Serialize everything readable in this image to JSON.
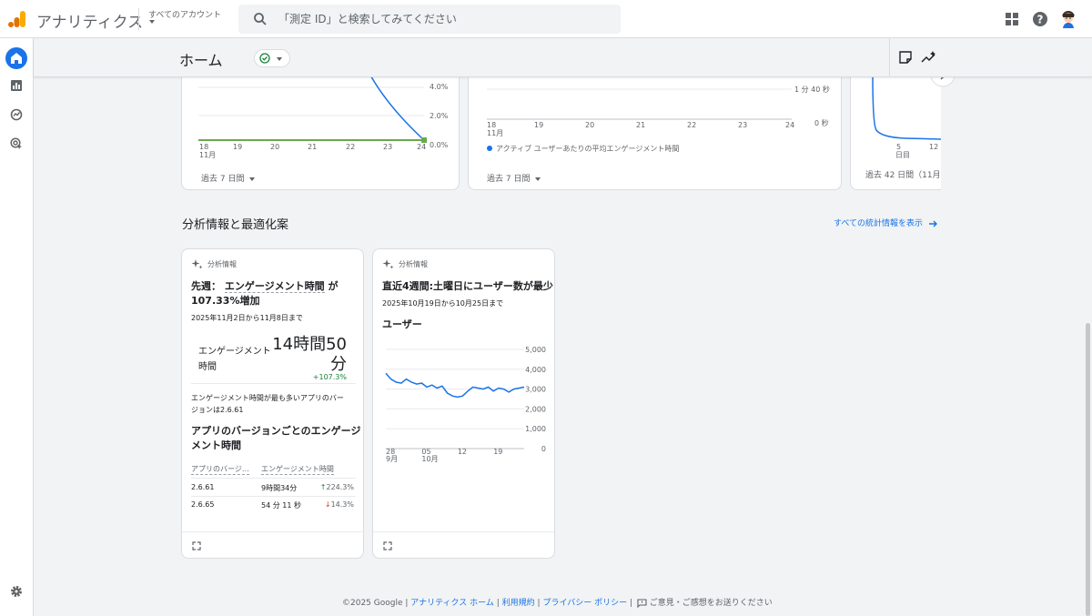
{
  "app": {
    "title": "アナリティクス",
    "account_selector": "すべてのアカウント",
    "search_placeholder": "「測定 ID」と検索してみてください",
    "brand_colors": {
      "accent": "#1a73e8",
      "logo_orange": "#f9ab00",
      "logo_dark_orange": "#e37400"
    }
  },
  "header": {
    "page_title": "ホーム"
  },
  "top_cards": {
    "card1": {
      "y_ticks": [
        "4.0%",
        "2.0%",
        "0.0%"
      ],
      "x_ticks": [
        "18",
        "19",
        "20",
        "21",
        "22",
        "23",
        "24"
      ],
      "x_month": "11月",
      "date_range": "過去 7 日間",
      "line_color": "#1a73e8",
      "baseline_color": "#6aa84f"
    },
    "card2": {
      "y_ticks": [
        "1 分 40 秒",
        "0 秒"
      ],
      "x_ticks": [
        "18",
        "19",
        "20",
        "21",
        "22",
        "23",
        "24"
      ],
      "x_month": "11月",
      "legend": "アクティブ ユーザーあたりの平均エンゲージメント時間",
      "date_range": "過去 7 日間"
    },
    "card3": {
      "x_ticks": [
        "5",
        "12"
      ],
      "x_sub": "日目",
      "date_range": "過去 42 日間（11月 24"
    }
  },
  "insights": {
    "section_title": "分析情報と最適化案",
    "see_all": "すべての統計情報を表示",
    "card1": {
      "label": "分析情報",
      "title_prefix": "先週：",
      "title_metric": "エンゲージメント時間",
      "title_suffix": "が",
      "title_line2": "107.33%増加",
      "date_range": "2025年11月2日から11月8日まで",
      "metric_label_1": "エンゲージメント",
      "metric_label_2": "時間",
      "metric_value_1": "14時間50",
      "metric_value_2": "分",
      "metric_change": "+107.3%",
      "note_1": "エンゲージメント時間が最も多いアプリのバー",
      "note_2": "ジョンは2.6.61",
      "table_title_1": "アプリのバージョンごとのエンゲージ",
      "table_title_2": "メント時間",
      "table_headers": [
        "アプリのバージ…",
        "エンゲージメント時間"
      ],
      "rows": [
        {
          "version": "2.6.61",
          "time": "9時間34分",
          "change": "224.3%",
          "direction": "up"
        },
        {
          "version": "2.6.65",
          "time": "54 分 11 秒",
          "change": "14.3%",
          "direction": "down"
        }
      ]
    },
    "card2": {
      "label": "分析情報",
      "title": "直近4週間:土曜日にユーザー数が最少",
      "date_range": "2025年10月19日から10月25日まで",
      "chart_title": "ユーザー"
    }
  },
  "chart_data": {
    "type": "line",
    "title": "ユーザー",
    "x_ticks": [
      "28",
      "05",
      "12",
      "19"
    ],
    "x_tick_sub": [
      "9月",
      "10月",
      "",
      ""
    ],
    "x": [
      "9/28",
      "9/29",
      "9/30",
      "10/1",
      "10/2",
      "10/3",
      "10/4",
      "10/5",
      "10/6",
      "10/7",
      "10/8",
      "10/9",
      "10/10",
      "10/11",
      "10/12",
      "10/13",
      "10/14",
      "10/15",
      "10/16",
      "10/17",
      "10/18",
      "10/19",
      "10/20",
      "10/21",
      "10/22",
      "10/23",
      "10/24",
      "10/25"
    ],
    "series": [
      {
        "values": [
          3800,
          3500,
          3350,
          3300,
          3500,
          3350,
          3250,
          3300,
          3100,
          3200,
          3050,
          3150,
          2800,
          2650,
          2600,
          2650,
          2900,
          3100,
          3050,
          3000,
          3100,
          2900,
          3050,
          3000,
          2850,
          3000,
          3050,
          3100
        ]
      }
    ],
    "y_ticks": [
      "5,000",
      "4,000",
      "3,000",
      "2,000",
      "1,000",
      "0"
    ],
    "ylim": [
      0,
      5000
    ],
    "grid": true,
    "color": "#1a73e8"
  },
  "footer": {
    "copyright": "©2025 Google",
    "links": [
      "アナリティクス ホーム",
      "利用規約",
      "プライバシー ポリシー"
    ],
    "feedback": "ご意見・ご感想をお送りください"
  }
}
